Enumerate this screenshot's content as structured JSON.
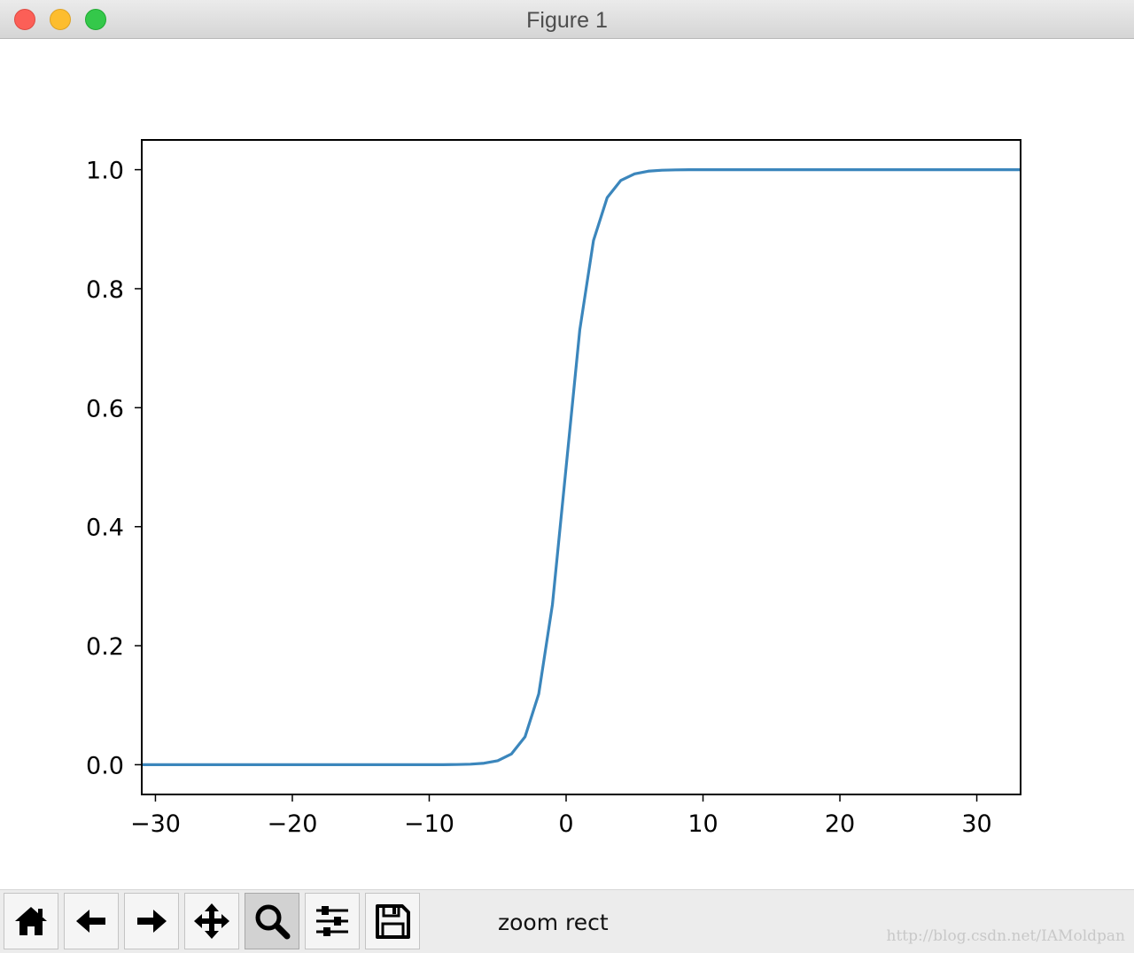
{
  "window": {
    "title": "Figure 1"
  },
  "toolbar": {
    "buttons": [
      {
        "icon": "home-icon",
        "label": "Home"
      },
      {
        "icon": "back-arrow-icon",
        "label": "Back"
      },
      {
        "icon": "forward-arrow-icon",
        "label": "Forward"
      },
      {
        "icon": "pan-move-icon",
        "label": "Pan"
      },
      {
        "icon": "zoom-magnifier-icon",
        "label": "Zoom",
        "active": true
      },
      {
        "icon": "subplots-sliders-icon",
        "label": "Configure subplots"
      },
      {
        "icon": "save-floppy-icon",
        "label": "Save"
      }
    ],
    "status": "zoom rect",
    "watermark": "http://blog.csdn.net/IAMoldpan"
  },
  "chart_data": {
    "type": "line",
    "title": "",
    "xlabel": "",
    "ylabel": "",
    "xlim": [
      -31,
      33.2
    ],
    "ylim": [
      -0.05,
      1.05
    ],
    "xticks": [
      -30,
      -20,
      -10,
      0,
      10,
      20,
      30
    ],
    "xtick_labels": [
      "−30",
      "−20",
      "−10",
      "0",
      "10",
      "20",
      "30"
    ],
    "yticks": [
      0.0,
      0.2,
      0.4,
      0.6,
      0.8,
      1.0
    ],
    "ytick_labels": [
      "0.0",
      "0.2",
      "0.4",
      "0.6",
      "0.8",
      "1.0"
    ],
    "grid": false,
    "legend": false,
    "line_color": "#3b86bc",
    "series": [
      {
        "x": [
          -31,
          -10,
          -9,
          -8,
          -7,
          -6,
          -5,
          -4,
          -3,
          -2,
          -1,
          0,
          1,
          2,
          3,
          4,
          5,
          6,
          7,
          8,
          9,
          10,
          33.2
        ],
        "y": [
          0.0,
          0.0,
          0.0001,
          0.0003,
          0.0009,
          0.0025,
          0.0067,
          0.018,
          0.047,
          0.119,
          0.269,
          0.5,
          0.731,
          0.881,
          0.953,
          0.982,
          0.993,
          0.9975,
          0.9991,
          0.9997,
          0.9999,
          1.0,
          1.0
        ]
      }
    ]
  }
}
